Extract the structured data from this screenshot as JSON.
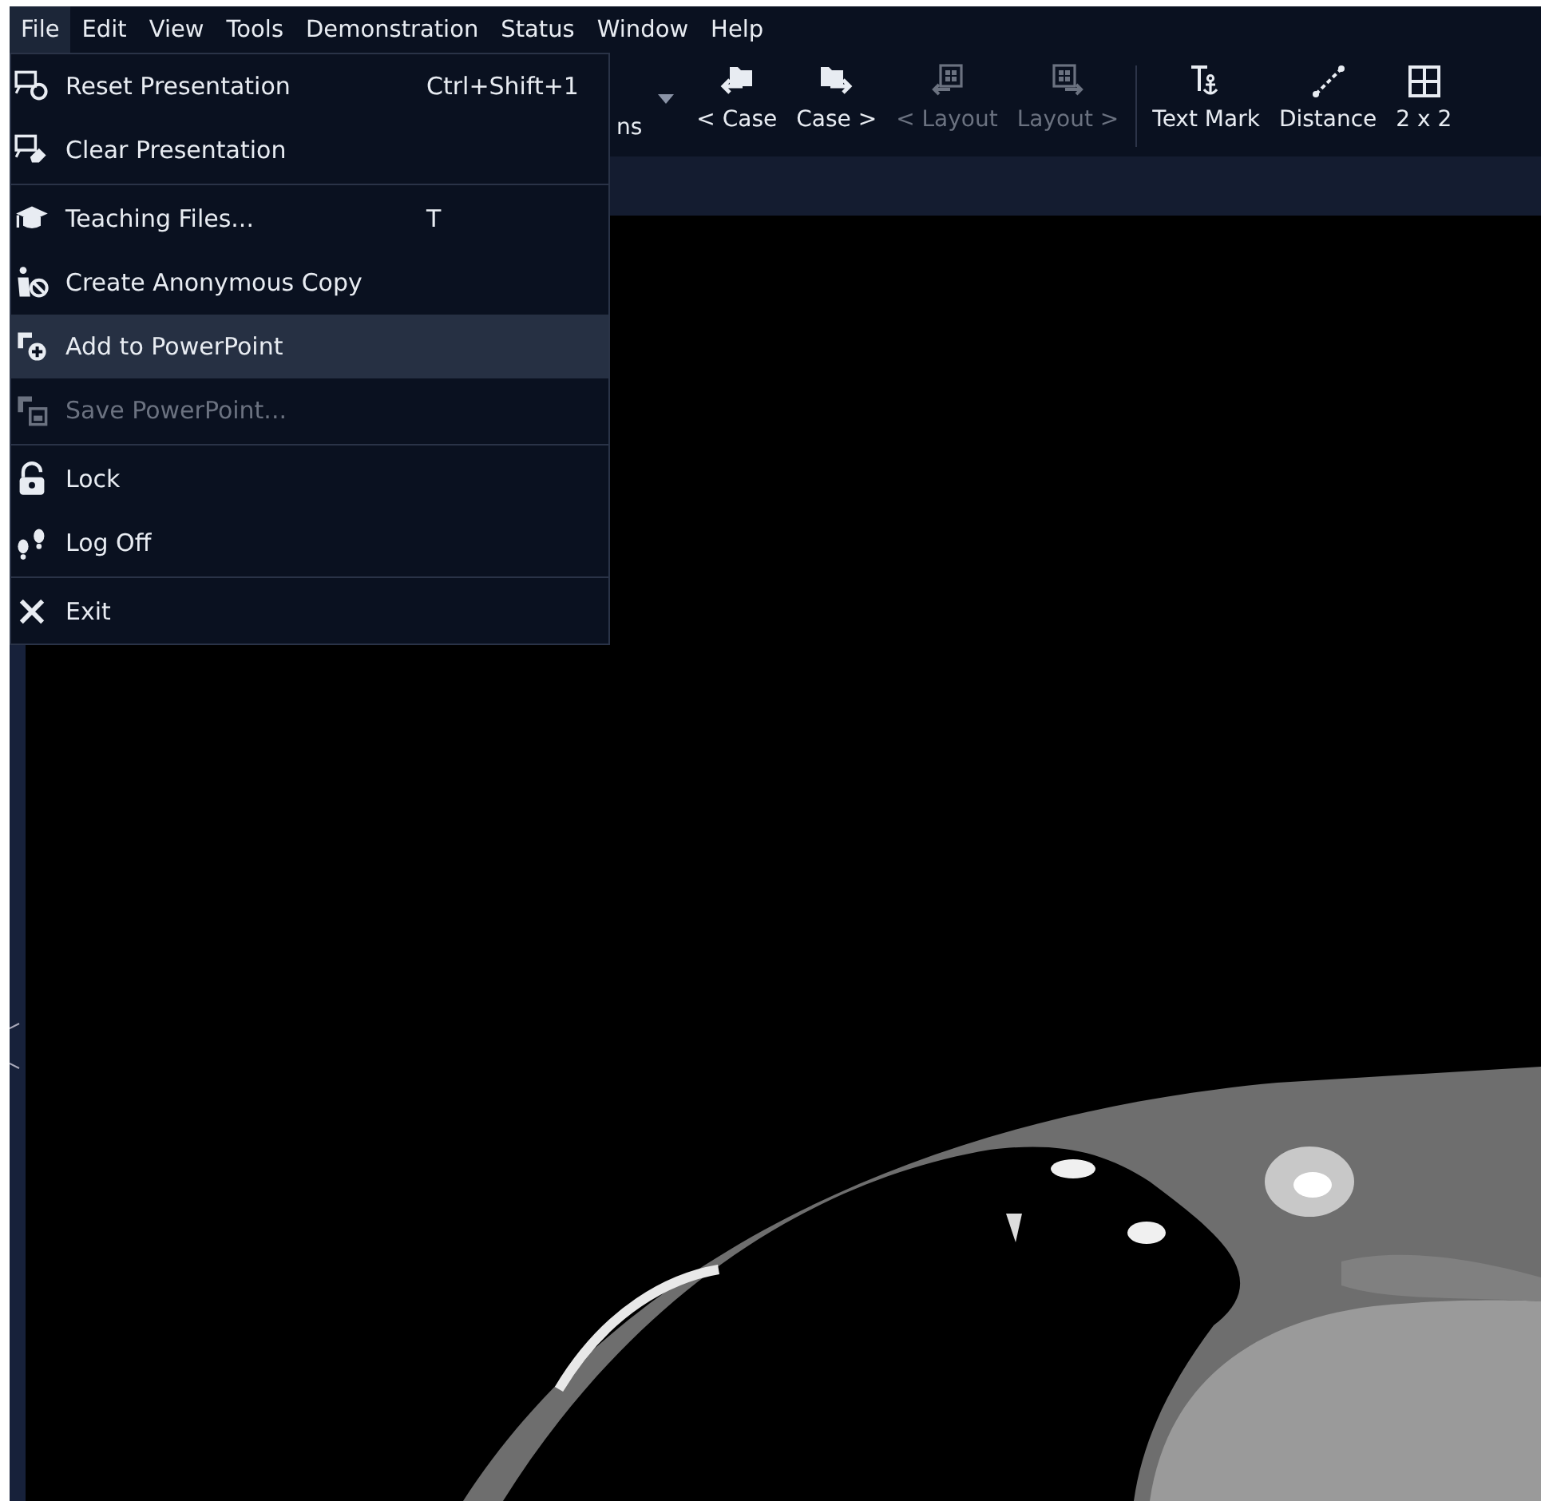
{
  "menu_bar": [
    {
      "label": "File",
      "selected": true
    },
    {
      "label": "Edit",
      "selected": false
    },
    {
      "label": "View",
      "selected": false
    },
    {
      "label": "Tools",
      "selected": false
    },
    {
      "label": "Demonstration",
      "selected": false
    },
    {
      "label": "Status",
      "selected": false
    },
    {
      "label": "Window",
      "selected": false
    },
    {
      "label": "Help",
      "selected": false
    }
  ],
  "toolbar": {
    "partial_label": "ns",
    "buttons": [
      {
        "label": "< Case",
        "disabled": false
      },
      {
        "label": "Case >",
        "disabled": false
      },
      {
        "label": "< Layout",
        "disabled": true
      },
      {
        "label": "Layout >",
        "disabled": true
      },
      {
        "label": "Text Mark",
        "disabled": false
      },
      {
        "label": "Distance",
        "disabled": false
      },
      {
        "label": "2 x 2",
        "disabled": false
      }
    ]
  },
  "file_menu": [
    {
      "kind": "item",
      "label": "Reset Presentation",
      "shortcut": "Ctrl+Shift+1",
      "disabled": false,
      "selected": false
    },
    {
      "kind": "item",
      "label": "Clear Presentation",
      "disabled": false,
      "selected": false
    },
    {
      "kind": "separator"
    },
    {
      "kind": "item",
      "label": "Teaching Files...",
      "shortcut": "T",
      "disabled": false,
      "selected": false
    },
    {
      "kind": "item",
      "label": "Create Anonymous Copy",
      "disabled": false,
      "selected": false
    },
    {
      "kind": "item",
      "label": "Add to PowerPoint",
      "disabled": false,
      "selected": true
    },
    {
      "kind": "item",
      "label": "Save PowerPoint...",
      "disabled": true,
      "selected": false
    },
    {
      "kind": "separator"
    },
    {
      "kind": "item",
      "label": "Lock",
      "disabled": false,
      "selected": false
    },
    {
      "kind": "item",
      "label": "Log Off",
      "disabled": false,
      "selected": false
    },
    {
      "kind": "separator"
    },
    {
      "kind": "item",
      "label": "Exit",
      "disabled": false,
      "selected": false
    }
  ]
}
